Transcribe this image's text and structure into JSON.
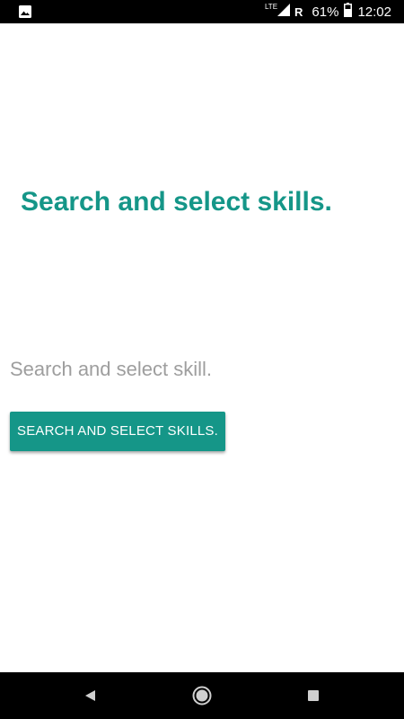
{
  "status_bar": {
    "network": "LTE",
    "roaming": "R",
    "battery": "61%",
    "time": "12:02",
    "left_icon": "image-icon"
  },
  "main": {
    "headline": "Search and select skills.",
    "hint": "Search and select skill.",
    "button_label": "SEARCH AND SELECT SKILLS."
  },
  "colors": {
    "accent": "#159688",
    "hint": "#9e9e9e"
  },
  "nav_bar": {
    "icons": [
      "back-icon",
      "home-icon",
      "recents-icon"
    ]
  }
}
